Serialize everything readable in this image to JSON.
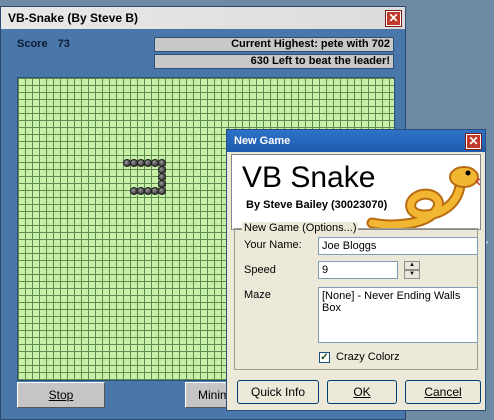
{
  "main_window": {
    "title": "VB-Snake (By Steve B)",
    "score_label": "Score",
    "score_value": "73",
    "highest_text": "Current Highest: pete with 702",
    "left_text": "630 Left to beat the leader!",
    "stop_label": "Stop",
    "minimize_label": "Minimi"
  },
  "dialog": {
    "title": "New Game",
    "banner_title": "VB Snake",
    "banner_subtitle": "By Steve Bailey (30023070)",
    "group_label": "New Game (Options...)",
    "name_label": "Your Name:",
    "name_value": "Joe Bloggs",
    "speed_label": "Speed",
    "speed_value": "9",
    "maze_label": "Maze",
    "maze_options": [
      "[None] - Never Ending Walls",
      "Box"
    ],
    "crazy_label": "Crazy Colorz",
    "crazy_checked": true,
    "quick_info_label": "Quick Info",
    "ok_label": "OK",
    "cancel_label": "Cancel"
  },
  "icons": {
    "close": "close-icon",
    "checkmark": "checkmark-icon",
    "spin_up": "chevron-up-icon",
    "spin_down": "chevron-down-icon"
  },
  "colors": {
    "board_bg": "#c8f0a8",
    "grid": "#5e8c4e",
    "window_bg": "#4a77a9",
    "dialog_title": "#2d72c8"
  }
}
